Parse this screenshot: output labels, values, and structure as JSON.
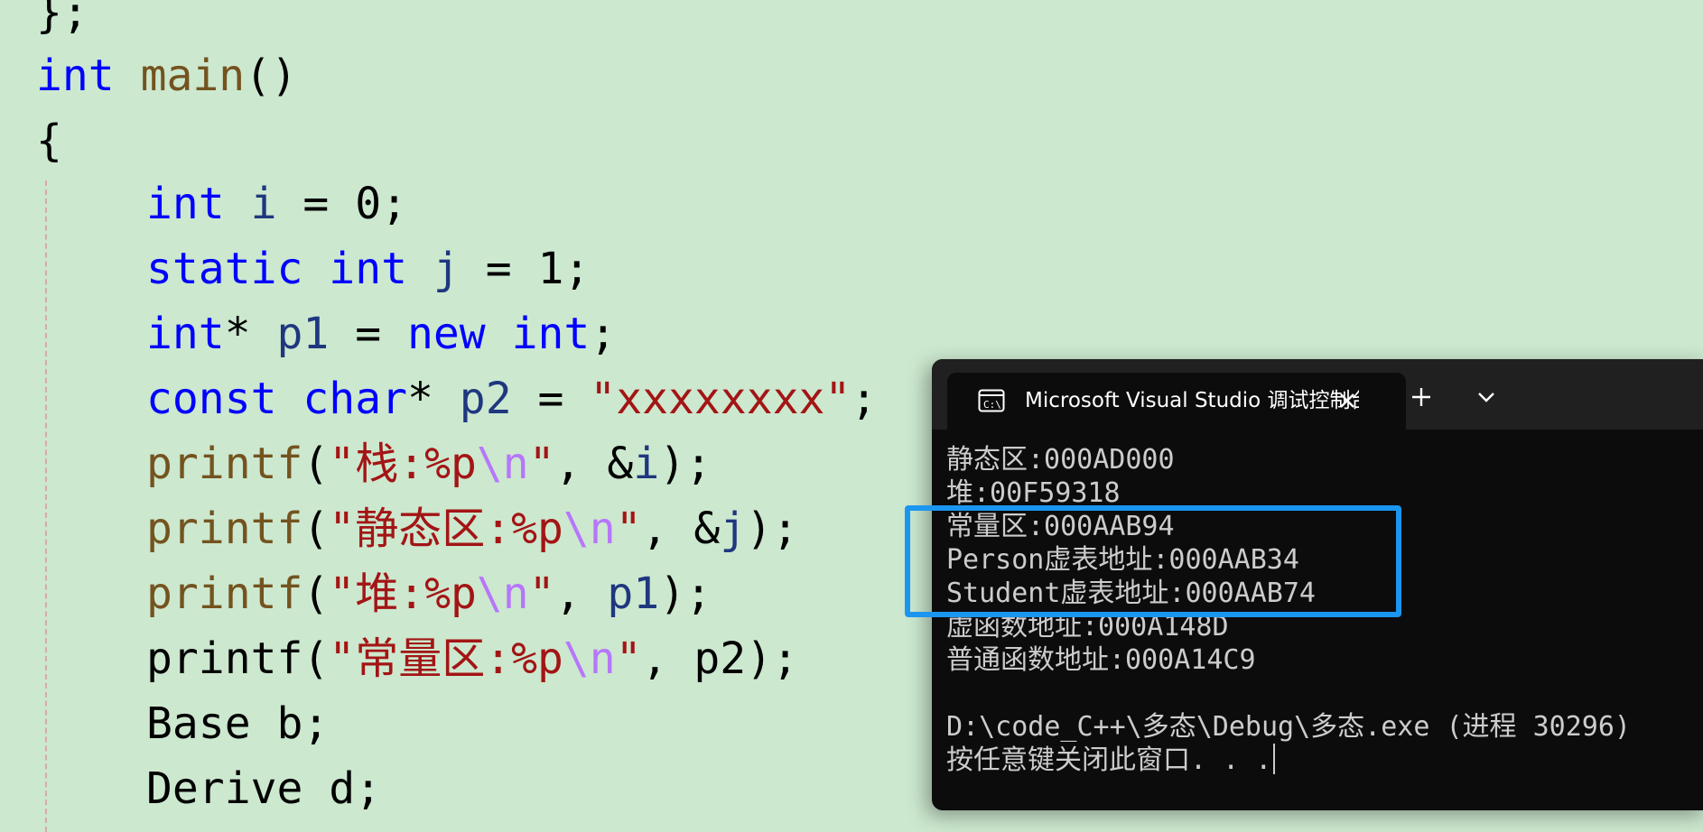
{
  "editor": {
    "lines": [
      {
        "segments": [
          {
            "t": "};",
            "c": "pl"
          }
        ]
      },
      {
        "segments": [
          {
            "t": "int",
            "c": "kw"
          },
          {
            "t": " ",
            "c": "pl"
          },
          {
            "t": "main",
            "c": "fn"
          },
          {
            "t": "()",
            "c": "pl"
          }
        ]
      },
      {
        "segments": [
          {
            "t": "{",
            "c": "pl"
          }
        ]
      },
      {
        "segments": [
          {
            "t": "int",
            "c": "kw"
          },
          {
            "t": " ",
            "c": "pl"
          },
          {
            "t": "i",
            "c": "var"
          },
          {
            "t": " = 0;",
            "c": "pl"
          }
        ]
      },
      {
        "segments": [
          {
            "t": "static",
            "c": "kw"
          },
          {
            "t": " ",
            "c": "pl"
          },
          {
            "t": "int",
            "c": "kw"
          },
          {
            "t": " ",
            "c": "pl"
          },
          {
            "t": "j",
            "c": "var"
          },
          {
            "t": " = 1;",
            "c": "pl"
          }
        ]
      },
      {
        "segments": [
          {
            "t": "int",
            "c": "kw"
          },
          {
            "t": "* ",
            "c": "pl"
          },
          {
            "t": "p1",
            "c": "var"
          },
          {
            "t": " = ",
            "c": "pl"
          },
          {
            "t": "new",
            "c": "kw"
          },
          {
            "t": " ",
            "c": "pl"
          },
          {
            "t": "int",
            "c": "kw"
          },
          {
            "t": ";",
            "c": "pl"
          }
        ]
      },
      {
        "segments": [
          {
            "t": "const",
            "c": "kw"
          },
          {
            "t": " ",
            "c": "pl"
          },
          {
            "t": "char",
            "c": "kw"
          },
          {
            "t": "* ",
            "c": "pl"
          },
          {
            "t": "p2",
            "c": "var"
          },
          {
            "t": " = ",
            "c": "pl"
          },
          {
            "t": "\"xxxxxxxx\"",
            "c": "str"
          },
          {
            "t": ";",
            "c": "pl"
          }
        ]
      },
      {
        "segments": [
          {
            "t": "printf",
            "c": "fn"
          },
          {
            "t": "(",
            "c": "pl"
          },
          {
            "t": "\"栈:%p",
            "c": "str"
          },
          {
            "t": "\\n",
            "c": "esc"
          },
          {
            "t": "\"",
            "c": "str"
          },
          {
            "t": ", &",
            "c": "pl"
          },
          {
            "t": "i",
            "c": "var"
          },
          {
            "t": ");",
            "c": "pl"
          }
        ]
      },
      {
        "segments": [
          {
            "t": "printf",
            "c": "fn"
          },
          {
            "t": "(",
            "c": "pl"
          },
          {
            "t": "\"静态区:%p",
            "c": "str"
          },
          {
            "t": "\\n",
            "c": "esc"
          },
          {
            "t": "\"",
            "c": "str"
          },
          {
            "t": ", &",
            "c": "pl"
          },
          {
            "t": "j",
            "c": "var"
          },
          {
            "t": ");",
            "c": "pl"
          }
        ]
      },
      {
        "segments": [
          {
            "t": "printf",
            "c": "fn"
          },
          {
            "t": "(",
            "c": "pl"
          },
          {
            "t": "\"堆:%p",
            "c": "str"
          },
          {
            "t": "\\n",
            "c": "esc"
          },
          {
            "t": "\"",
            "c": "str"
          },
          {
            "t": ", ",
            "c": "pl"
          },
          {
            "t": "p1",
            "c": "var"
          },
          {
            "t": ");",
            "c": "pl"
          }
        ]
      },
      {
        "segments": [
          {
            "t": "printf(",
            "c": "pl"
          },
          {
            "t": "\"常量区:%p",
            "c": "str"
          },
          {
            "t": "\\n",
            "c": "esc"
          },
          {
            "t": "\"",
            "c": "str"
          },
          {
            "t": ", p2);",
            "c": "pl"
          }
        ]
      },
      {
        "segments": [
          {
            "t": "Base b;",
            "c": "pl"
          }
        ]
      },
      {
        "segments": [
          {
            "t": "Derive d;",
            "c": "pl"
          }
        ]
      }
    ]
  },
  "terminal": {
    "tab_title": "Microsoft Visual Studio 调试控制台",
    "lines": [
      "静态区:000AD000",
      "堆:00F59318",
      "常量区:000AAB94",
      "Person虚表地址:000AAB34",
      "Student虚表地址:000AAB74",
      "虚函数地址:000A148D",
      "普通函数地址:000A14C9",
      "",
      "D:\\code_C++\\多态\\Debug\\多态.exe (进程 30296)",
      "按任意键关闭此窗口. . ."
    ]
  },
  "colors": {
    "editor_background": "#cce8cf",
    "keyword": "#0000ff",
    "function": "#74531f",
    "string": "#a31515",
    "escape": "#b776fb",
    "variable": "#1f377f",
    "terminal_background": "#0c0c0c",
    "terminal_text": "#cccccc",
    "highlight_border": "#1a96f0"
  },
  "icons": {
    "terminal_app": "terminal-app-icon",
    "close": "close-icon",
    "new_tab": "plus-icon",
    "dropdown": "chevron-down-icon"
  }
}
